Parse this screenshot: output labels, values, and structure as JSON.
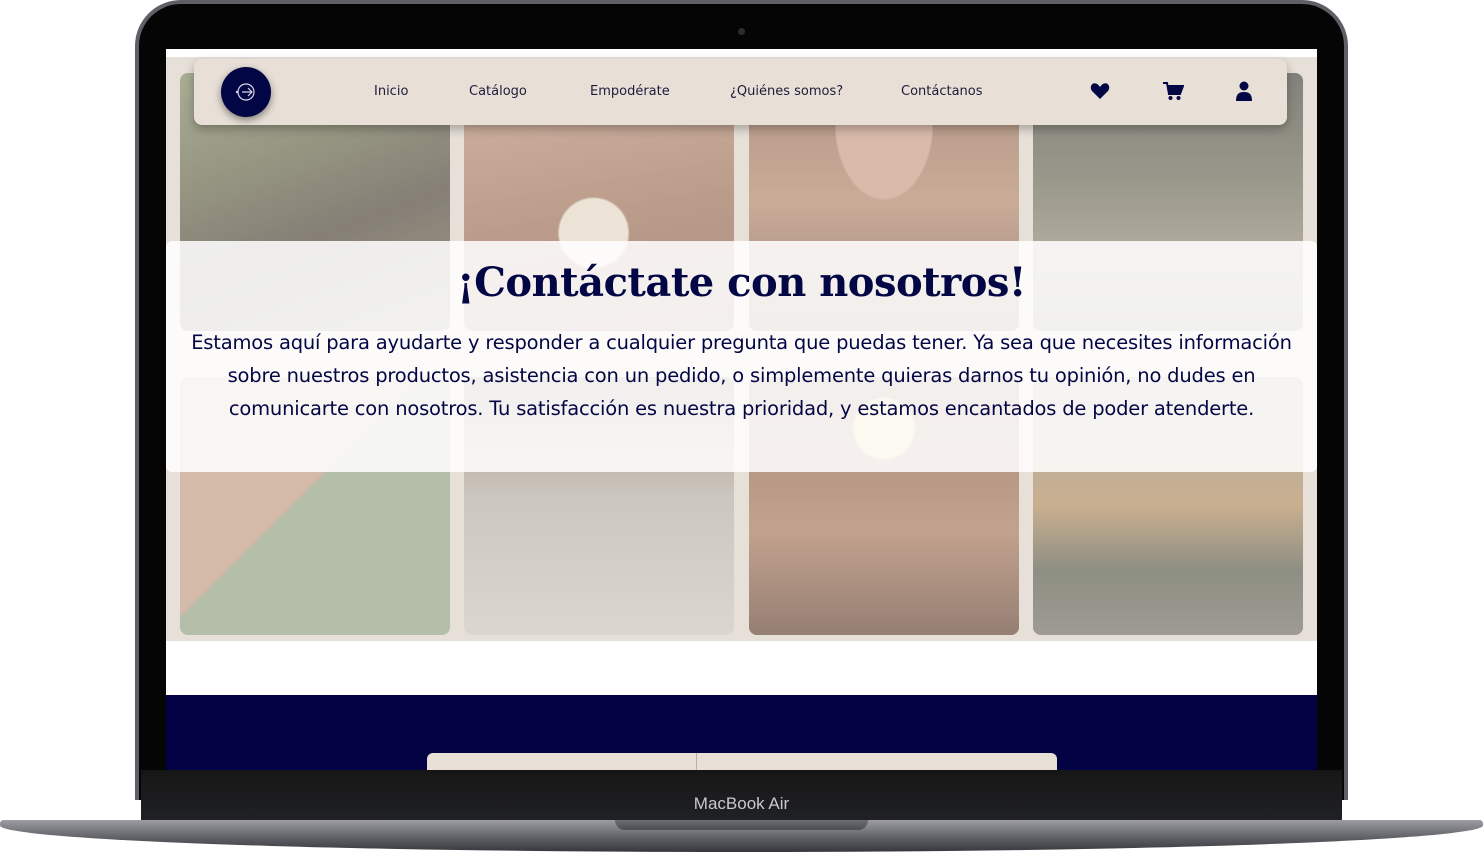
{
  "device": {
    "label": "MacBook Air"
  },
  "nav": {
    "logo_name": "brand-logo",
    "links": [
      "Inicio",
      "Catálogo",
      "Empodérate",
      "¿Quiénes somos?",
      "Contáctanos"
    ],
    "icons": [
      "heart-icon",
      "cart-icon",
      "user-icon"
    ]
  },
  "hero": {
    "title": "¡Contáctate con nosotros!",
    "body": "Estamos aquí para ayudarte y responder a cualquier pregunta que puedas tener. Ya sea que necesites información sobre nuestros productos, asistencia con un pedido, o simplemente quieras darnos tu opinión, no dudes en comunicarte con nosotros. Tu satisfacción es nuestra prioridad, y estamos encantados de poder atenderte."
  },
  "colors": {
    "navy": "#030644",
    "beige": "#e8e0d7",
    "footer": "#020143"
  }
}
